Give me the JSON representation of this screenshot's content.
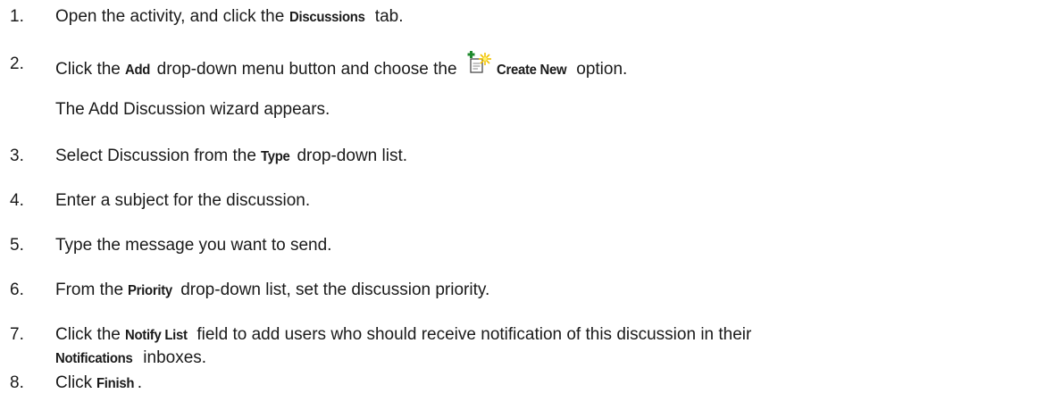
{
  "steps": [
    {
      "num": "1.",
      "parts": [
        {
          "t": "Open the activity, and click the ",
          "b": false
        },
        {
          "t": "Discussions",
          "b": true
        },
        {
          "t": " tab.",
          "b": false
        }
      ]
    },
    {
      "num": "2.",
      "parts": [
        {
          "t": "Click the ",
          "b": false
        },
        {
          "t": "Add",
          "b": true
        },
        {
          "t": " drop-down menu button and choose the ",
          "b": false
        },
        {
          "icon": "create-new-icon"
        },
        {
          "t": "Create New",
          "b": true
        },
        {
          "t": " option.",
          "b": false
        }
      ],
      "sub": "The Add Discussion wizard appears."
    },
    {
      "num": "3.",
      "parts": [
        {
          "t": "Select Discussion from the ",
          "b": false
        },
        {
          "t": "Type",
          "b": true
        },
        {
          "t": " drop-down list.",
          "b": false
        }
      ]
    },
    {
      "num": "4.",
      "parts": [
        {
          "t": "Enter a subject for the discussion.",
          "b": false
        }
      ]
    },
    {
      "num": "5.",
      "parts": [
        {
          "t": "Type the message you want to send.",
          "b": false
        }
      ]
    },
    {
      "num": "6.",
      "parts": [
        {
          "t": "From the ",
          "b": false
        },
        {
          "t": "Priority",
          "b": true
        },
        {
          "t": " drop-down list, set the discussion priority.",
          "b": false
        }
      ]
    },
    {
      "num": "7.",
      "parts": [
        {
          "t": "Click the ",
          "b": false
        },
        {
          "t": "Notify List",
          "b": true
        },
        {
          "t": " field to add users who should receive notification of this discussion in their",
          "b": false
        }
      ],
      "parts2": [
        {
          "t": "Notifications",
          "b": true
        },
        {
          "t": " inboxes.",
          "b": false
        }
      ]
    },
    {
      "num": "8.",
      "parts": [
        {
          "t": "Click ",
          "b": false
        },
        {
          "t": "Finish",
          "b": true
        },
        {
          "t": ".",
          "b": false
        }
      ]
    }
  ]
}
